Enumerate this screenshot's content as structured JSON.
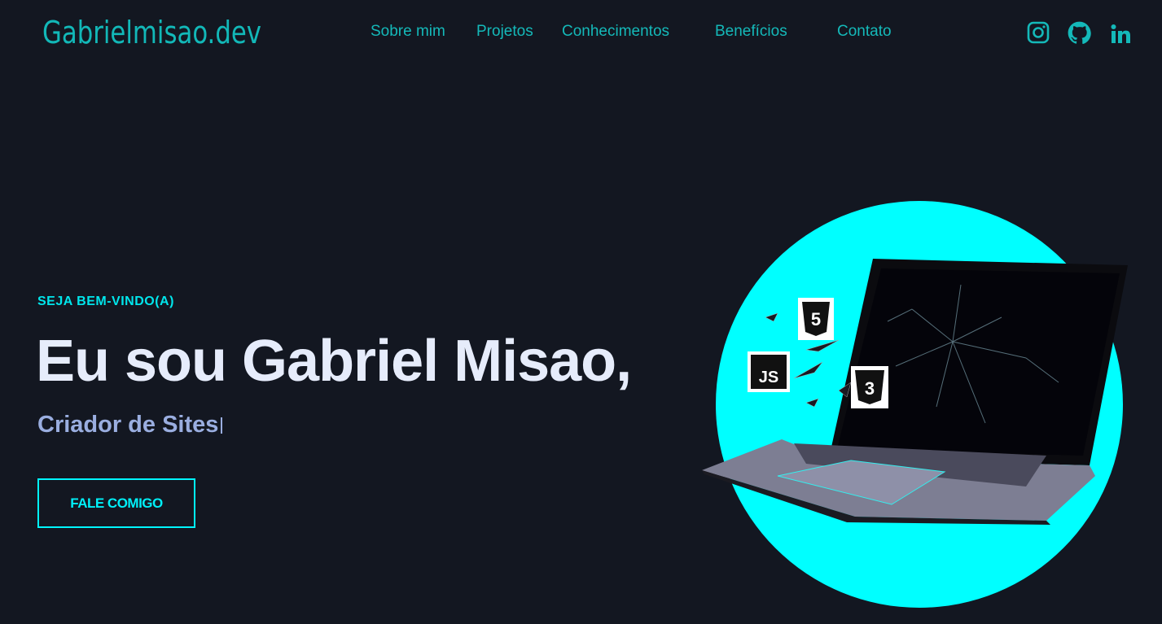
{
  "header": {
    "logo": "Gabrielmisao.dev",
    "nav": [
      {
        "label": "Sobre mim"
      },
      {
        "label": "Projetos"
      },
      {
        "label": "Conhecimentos"
      },
      {
        "label": "Benefícios"
      },
      {
        "label": "Contato"
      }
    ],
    "social": [
      {
        "icon": "instagram-icon"
      },
      {
        "icon": "github-icon"
      },
      {
        "icon": "linkedin-icon"
      }
    ]
  },
  "hero": {
    "eyebrow": "SEJA BEM-VINDO(A)",
    "title": "Eu sou Gabriel Misao,",
    "subtitle": "Criador de Sites",
    "cta": "FALE COMIGO",
    "badges": [
      "JS",
      "5",
      "3"
    ]
  },
  "colors": {
    "background": "#131721",
    "accent": "#14b9b9",
    "cyan": "#00ffff",
    "title": "#e6ecfb",
    "subtitle": "#9aaee0"
  }
}
